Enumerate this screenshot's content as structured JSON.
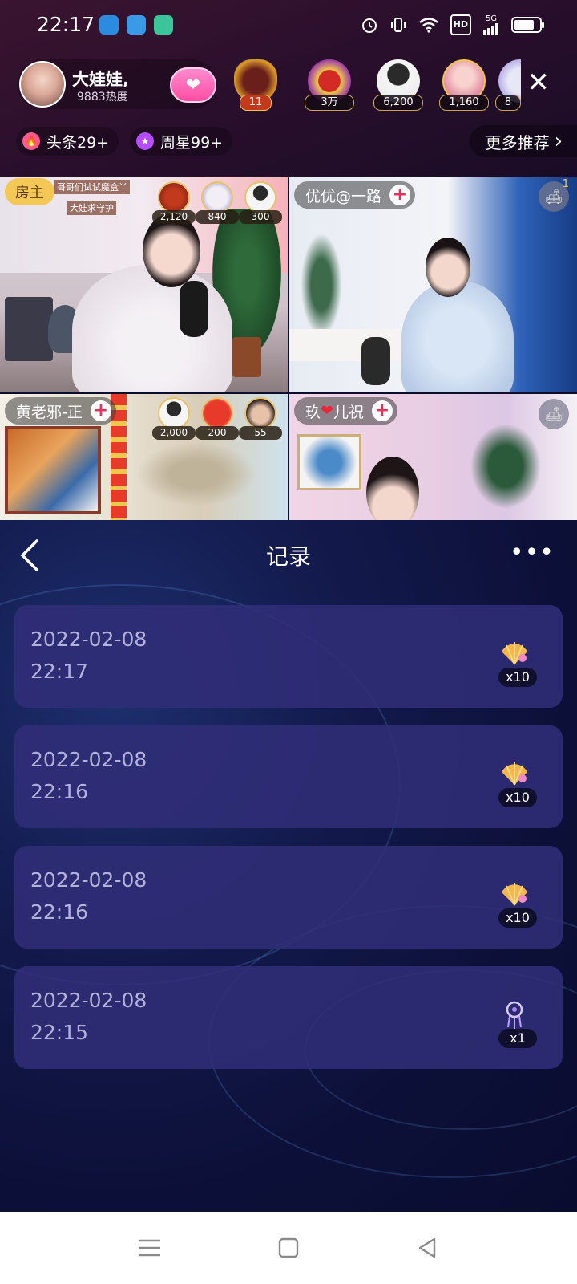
{
  "status_bar": {
    "time": "22:17",
    "notification_icons": [
      "video-app-icon",
      "cloud-app-icon",
      "book-app-icon"
    ],
    "right_icons": [
      "alarm-icon",
      "vibrate-icon",
      "wifi-icon",
      "hd-icon",
      "signal-5g-icon",
      "battery-icon"
    ],
    "hd_label": "HD",
    "network_label": "5G"
  },
  "live_header": {
    "host_name": "大娃娃,",
    "host_heat": "9883热度",
    "viewers": [
      {
        "label": "11",
        "icon": "guard-badge-icon"
      },
      {
        "label": "3万"
      },
      {
        "label": "6,200"
      },
      {
        "label": "1,160"
      },
      {
        "label": "8"
      }
    ],
    "chips": [
      {
        "label": "头条29+",
        "icon": "flame-icon",
        "color": "#ff5a8a"
      },
      {
        "label": "周星99+",
        "icon": "star-icon",
        "color": "#b54cff"
      }
    ],
    "more_recommend": "更多推荐"
  },
  "video_grid": {
    "tiles": [
      {
        "role": "房主",
        "overlay_lines": [
          "哥哥们试试魔盒丫",
          "大娃求守护"
        ],
        "gift_counts": [
          "2,120",
          "840",
          "300"
        ]
      },
      {
        "name": "优优@一路",
        "seat_count": "1"
      },
      {
        "name": "黄老邪-正",
        "gift_counts": [
          "2,000",
          "200",
          "55"
        ]
      },
      {
        "name": "玖",
        "name_suffix": "儿祝"
      }
    ]
  },
  "records": {
    "title": "记录",
    "items": [
      {
        "date": "2022-02-08",
        "time": "22:17",
        "gift_icon": "shell-gift-icon",
        "qty": "x10"
      },
      {
        "date": "2022-02-08",
        "time": "22:16",
        "gift_icon": "shell-gift-icon",
        "qty": "x10"
      },
      {
        "date": "2022-02-08",
        "time": "22:16",
        "gift_icon": "shell-gift-icon",
        "qty": "x10"
      },
      {
        "date": "2022-02-08",
        "time": "22:15",
        "gift_icon": "dreamcatcher-gift-icon",
        "qty": "x1"
      }
    ]
  }
}
